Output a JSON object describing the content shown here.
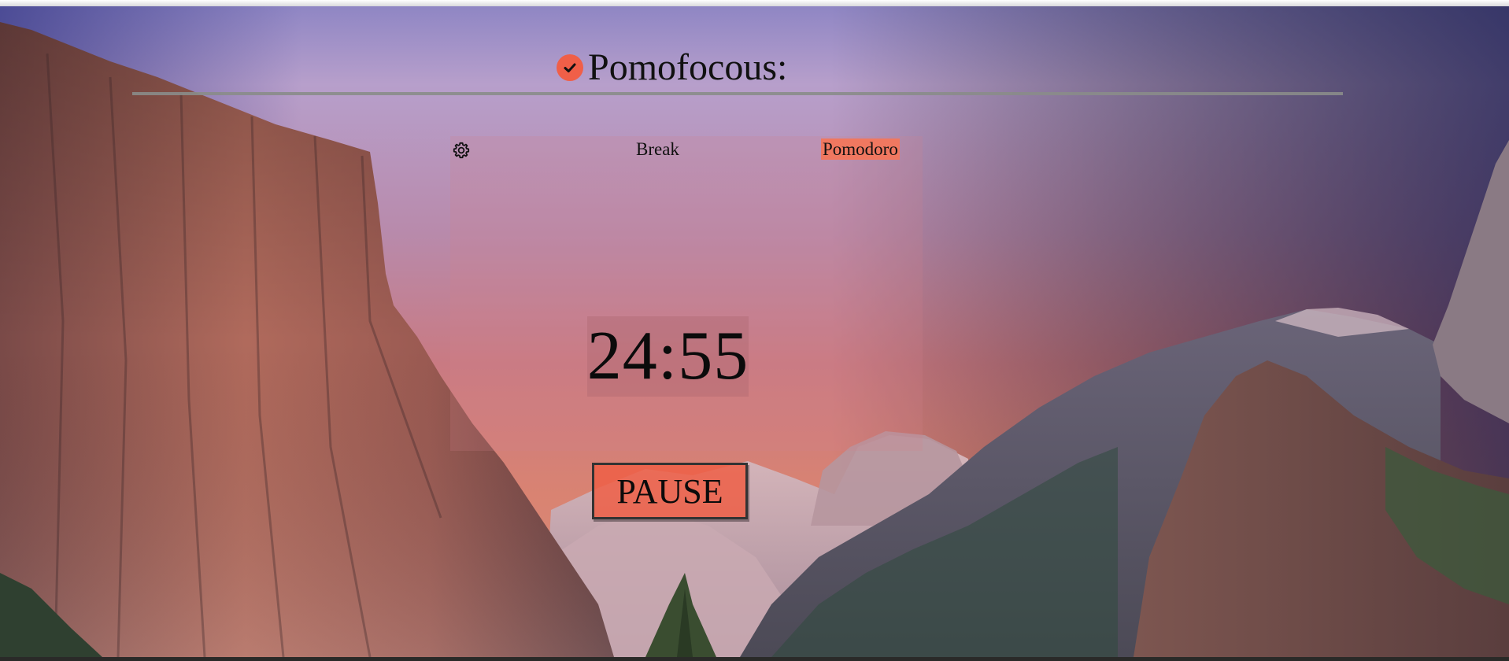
{
  "app": {
    "title": "Pomofocous:"
  },
  "tabs": [
    {
      "label": "Break",
      "active": false
    },
    {
      "label": "Pomodoro",
      "active": true
    }
  ],
  "timer": {
    "display": "24:55"
  },
  "controls": {
    "pause_label": "PAUSE"
  },
  "icons": {
    "settings": "gear-icon",
    "brand": "check-circle-icon"
  },
  "colors": {
    "accent": "#f05f48",
    "active_tab": "#f07860",
    "button": "#ee5f46"
  }
}
